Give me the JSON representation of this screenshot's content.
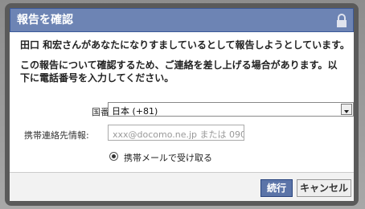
{
  "dialog": {
    "title": "報告を確認",
    "lock_icon": "lock-icon",
    "message1": "田口 和宏さんがあなたになりすましているとして報告しようとしています。",
    "message2": "この報告について確認するため、ご連絡を差し上げる場合があります。以下に電話番号を入力してください。",
    "country_label": "国番号:",
    "country_value": "日本 (+81)",
    "dropdown_icon": "chevron-down-icon",
    "mobile_label": "携帯連絡先情報:",
    "mobile_placeholder": "xxx@docomo.ne.jp または 090-xxxx",
    "radio_label": "携帯メールで受け取る",
    "continue_label": "続行",
    "cancel_label": "キャンセル"
  },
  "colors": {
    "header_bg": "#6d84b4",
    "primary_button": "#5b74a8"
  }
}
